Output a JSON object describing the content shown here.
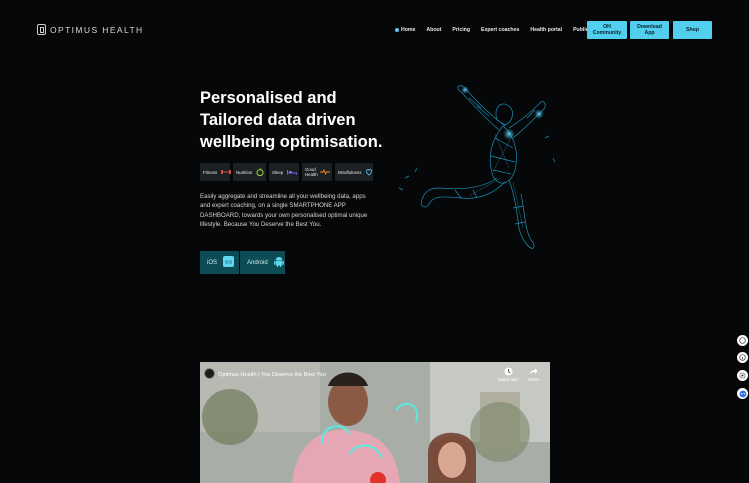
{
  "header": {
    "logo_text": "OPTIMUS HEALTH",
    "nav": [
      {
        "label": "Home",
        "active": true
      },
      {
        "label": "About"
      },
      {
        "label": "Pricing"
      },
      {
        "label": "Expert coaches"
      },
      {
        "label": "Health portal"
      },
      {
        "label": "Publications"
      }
    ],
    "buttons": {
      "community": "OH Community",
      "download": "Download App",
      "shop": "Shop"
    }
  },
  "hero": {
    "headline": "Personalised and Tailored data driven wellbeing optimisation.",
    "chips": [
      {
        "label": "Fitness",
        "icon": "dumbbell-icon"
      },
      {
        "label": "Nutrition",
        "icon": "apple-icon"
      },
      {
        "label": "Sleep",
        "icon": "bed-icon"
      },
      {
        "label": "Good Health",
        "icon": "heartbeat-icon"
      },
      {
        "label": "Mindfulness",
        "icon": "brain-icon"
      }
    ],
    "description": "Easily aggregate and streamline all your wellbeing data, apps and expert coaching, on a single SMARTPHONE APP DASHBOARD, towards your own personalised optimal unique lifestyle. Because You Deserve the Best You.",
    "store_buttons": {
      "ios_label": "iOS",
      "android_label": "Android"
    }
  },
  "video": {
    "title": "Optimus Health | You Deserve the Best You",
    "watch_later": "Watch later",
    "share": "Share"
  },
  "colors": {
    "background": "#060708",
    "accent": "#52cfee",
    "store_button": "#0d4c54",
    "chip": "#1d2023"
  }
}
